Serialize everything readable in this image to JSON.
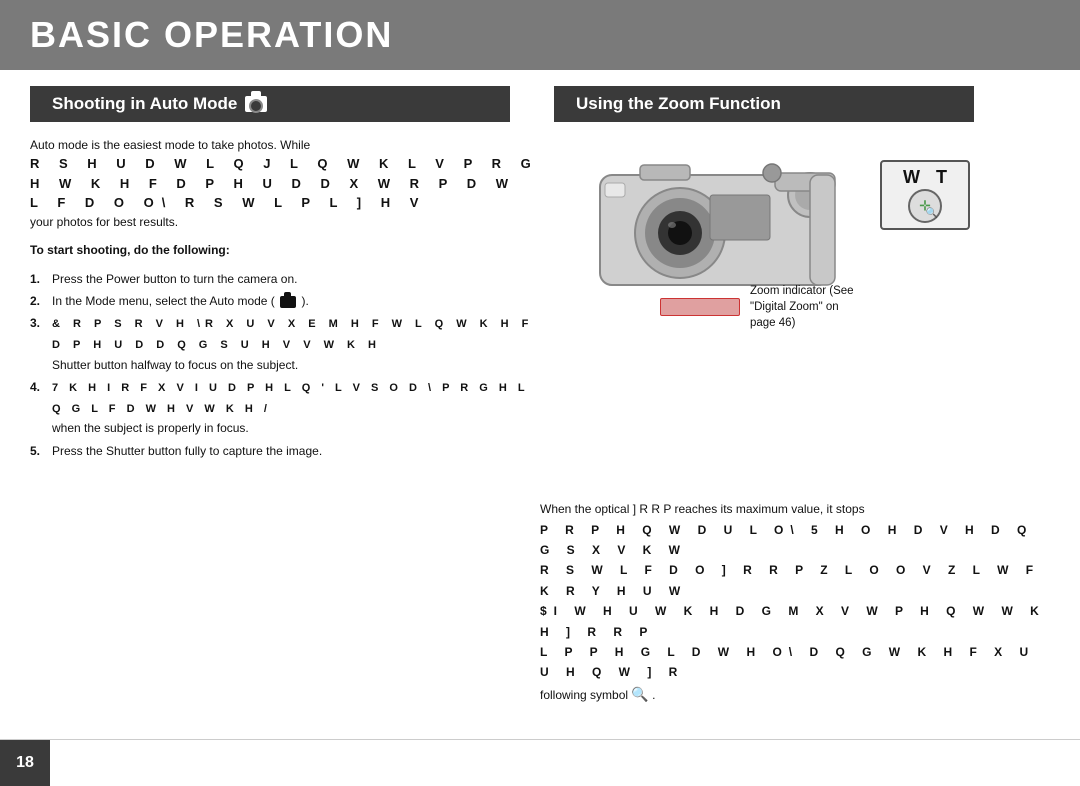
{
  "header": {
    "title": "BASIC OPERATION"
  },
  "sections": {
    "left_tab": "Shooting in Auto Mode",
    "right_tab": "Using the Zoom Function"
  },
  "left_content": {
    "intro_line1": "Auto mode is the easiest mode to take photos. While",
    "intro_line2": "R S H U D W L Q J  L Q  W K L V  P R G H   W K H  F D P H U D  D X W R P D W L F D O O\\  R S W L P L ] H V",
    "intro_line3": "your photos for best results.",
    "start_label": "To start shooting, do the following:",
    "steps": [
      {
        "num": "1.",
        "text": "Press the Power button to turn the camera on."
      },
      {
        "num": "2.",
        "text": "In the Mode menu, select the Auto mode ("
      },
      {
        "num": "3.",
        "text_line1": "& R P S R V H  \\R X U  V X E M H F W  L Q  W K H  F D P H U D  D Q G  S U H V V  W K H",
        "text_line2": "Shutter button halfway to focus on the subject."
      },
      {
        "num": "4.",
        "text_line1": "7 K H  I R F X V  I U D P H  L Q  ' L V S O D \\ P R G H  L Q G L F D W H V  W K H  /",
        "text_line2": "when the subject is properly in focus."
      },
      {
        "num": "5.",
        "text": "Press the Shutter button fully to capture the image."
      }
    ]
  },
  "right_content": {
    "wt_label_w": "W",
    "wt_label_t": "T",
    "zoom_indicator_label": "Zoom indicator (See",
    "zoom_indicator_sub1": "\"Digital Zoom\" on",
    "zoom_indicator_sub2": "page 46)"
  },
  "bottom_content": {
    "line1": "When the optical  ] R R P  reaches its maximum value, it stops",
    "line2": "P R P H Q W D U L O\\   5 H O H D V H  D Q G  S X V K  W",
    "line3": "R S W L F D O  ] R R P  Z L O O  V Z L W F K  R Y H U  W",
    "line4": "$I W H U  W K H  D G M X V W P H Q W   W K H  ] R R P",
    "line5": "L P P H G L D W H O\\  D Q G  W K H  F X U U H Q W  ] R",
    "line6_prefix": "following symbol",
    "line6_symbol": "🔍"
  },
  "footer": {
    "page_number": "18"
  }
}
